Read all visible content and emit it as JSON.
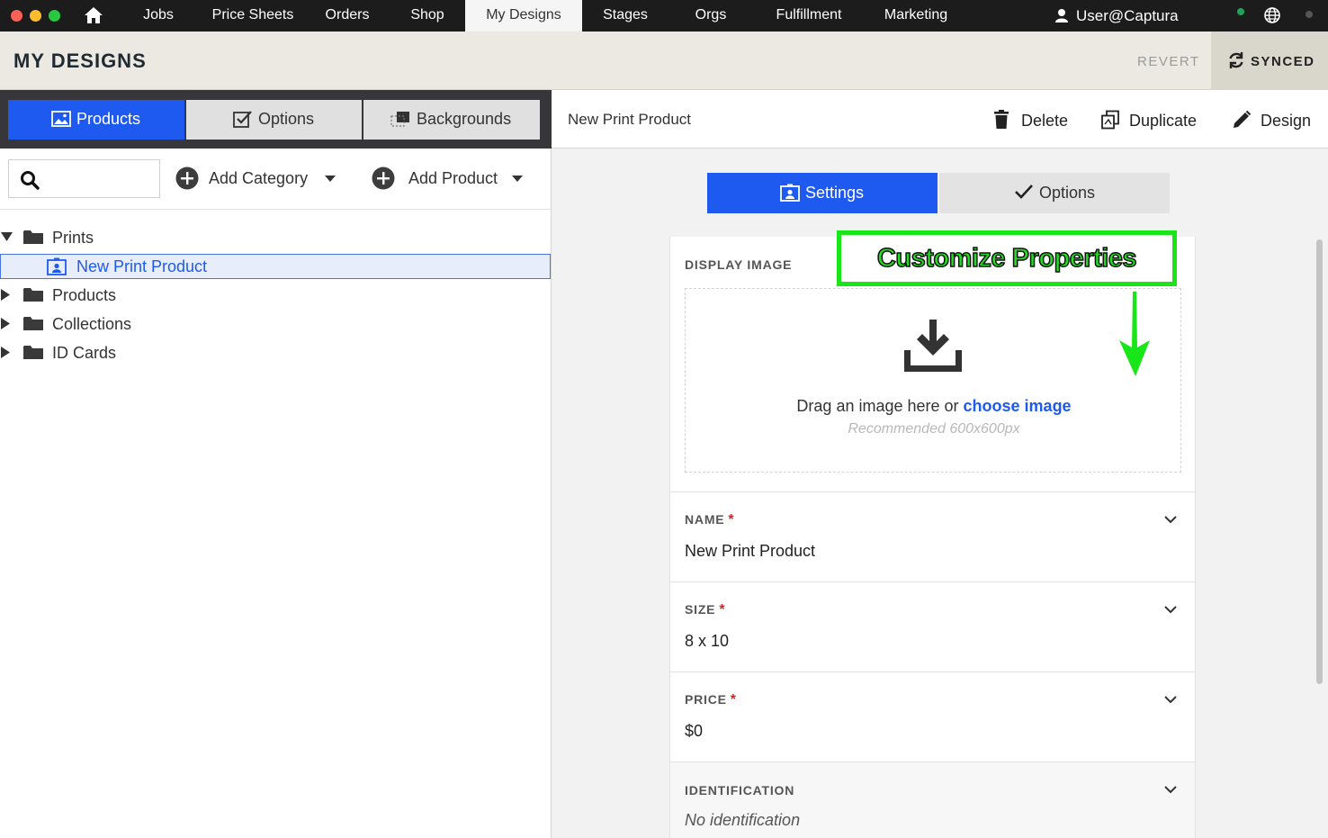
{
  "colors": {
    "accent": "#1f5af0",
    "nav_bg": "#1c1c1c",
    "annotation_green": "#19e619",
    "required_red": "#e02020"
  },
  "nav": {
    "items": [
      "Jobs",
      "Price Sheets",
      "Orders",
      "Shop",
      "My Designs",
      "Stages",
      "Orgs",
      "Fulfillment",
      "Marketing"
    ],
    "active": "My Designs",
    "user": "User@Captura"
  },
  "header": {
    "title": "MY DESIGNS",
    "revert_label": "REVERT",
    "synced_label": "SYNCED"
  },
  "left": {
    "tabs": [
      "Products",
      "Options",
      "Backgrounds"
    ],
    "active_tab": "Products",
    "search_placeholder": "",
    "add_category_label": "Add Category",
    "add_product_label": "Add Product",
    "tree": [
      {
        "label": "Prints",
        "expanded": true
      },
      {
        "label": "New Print Product",
        "selected": true
      },
      {
        "label": "Products",
        "expanded": false
      },
      {
        "label": "Collections",
        "expanded": false
      },
      {
        "label": "ID Cards",
        "expanded": false
      }
    ]
  },
  "right": {
    "product_name": "New Print Product",
    "actions": [
      "Delete",
      "Duplicate",
      "Design"
    ],
    "subtabs": [
      "Settings",
      "Options"
    ],
    "active_subtab": "Settings",
    "display_image": {
      "label": "DISPLAY IMAGE",
      "drag_text": "Drag an image here or ",
      "choose_link": "choose image",
      "recommend": "Recommended 600x600px"
    },
    "fields": [
      {
        "label": "NAME",
        "required": true,
        "value": "New Print Product"
      },
      {
        "label": "SIZE",
        "required": true,
        "value": "8 x 10"
      },
      {
        "label": "PRICE",
        "required": true,
        "value": "$0"
      },
      {
        "label": "IDENTIFICATION",
        "required": false,
        "value": "No identification"
      }
    ]
  },
  "annotation": {
    "text": "Customize Properties"
  },
  "icons": [
    "home-icon",
    "user-icon",
    "globe-icon",
    "sync-icon",
    "image-icon",
    "checkbox-icon",
    "backgrounds-icon",
    "search-icon",
    "plus-circle-icon",
    "caret-down-icon",
    "folder-icon",
    "portrait-icon",
    "trash-icon",
    "duplicate-icon",
    "pencil-icon",
    "settings-portrait-icon",
    "check-icon",
    "download-icon",
    "chevron-down-icon",
    "green-arrow-icon"
  ]
}
